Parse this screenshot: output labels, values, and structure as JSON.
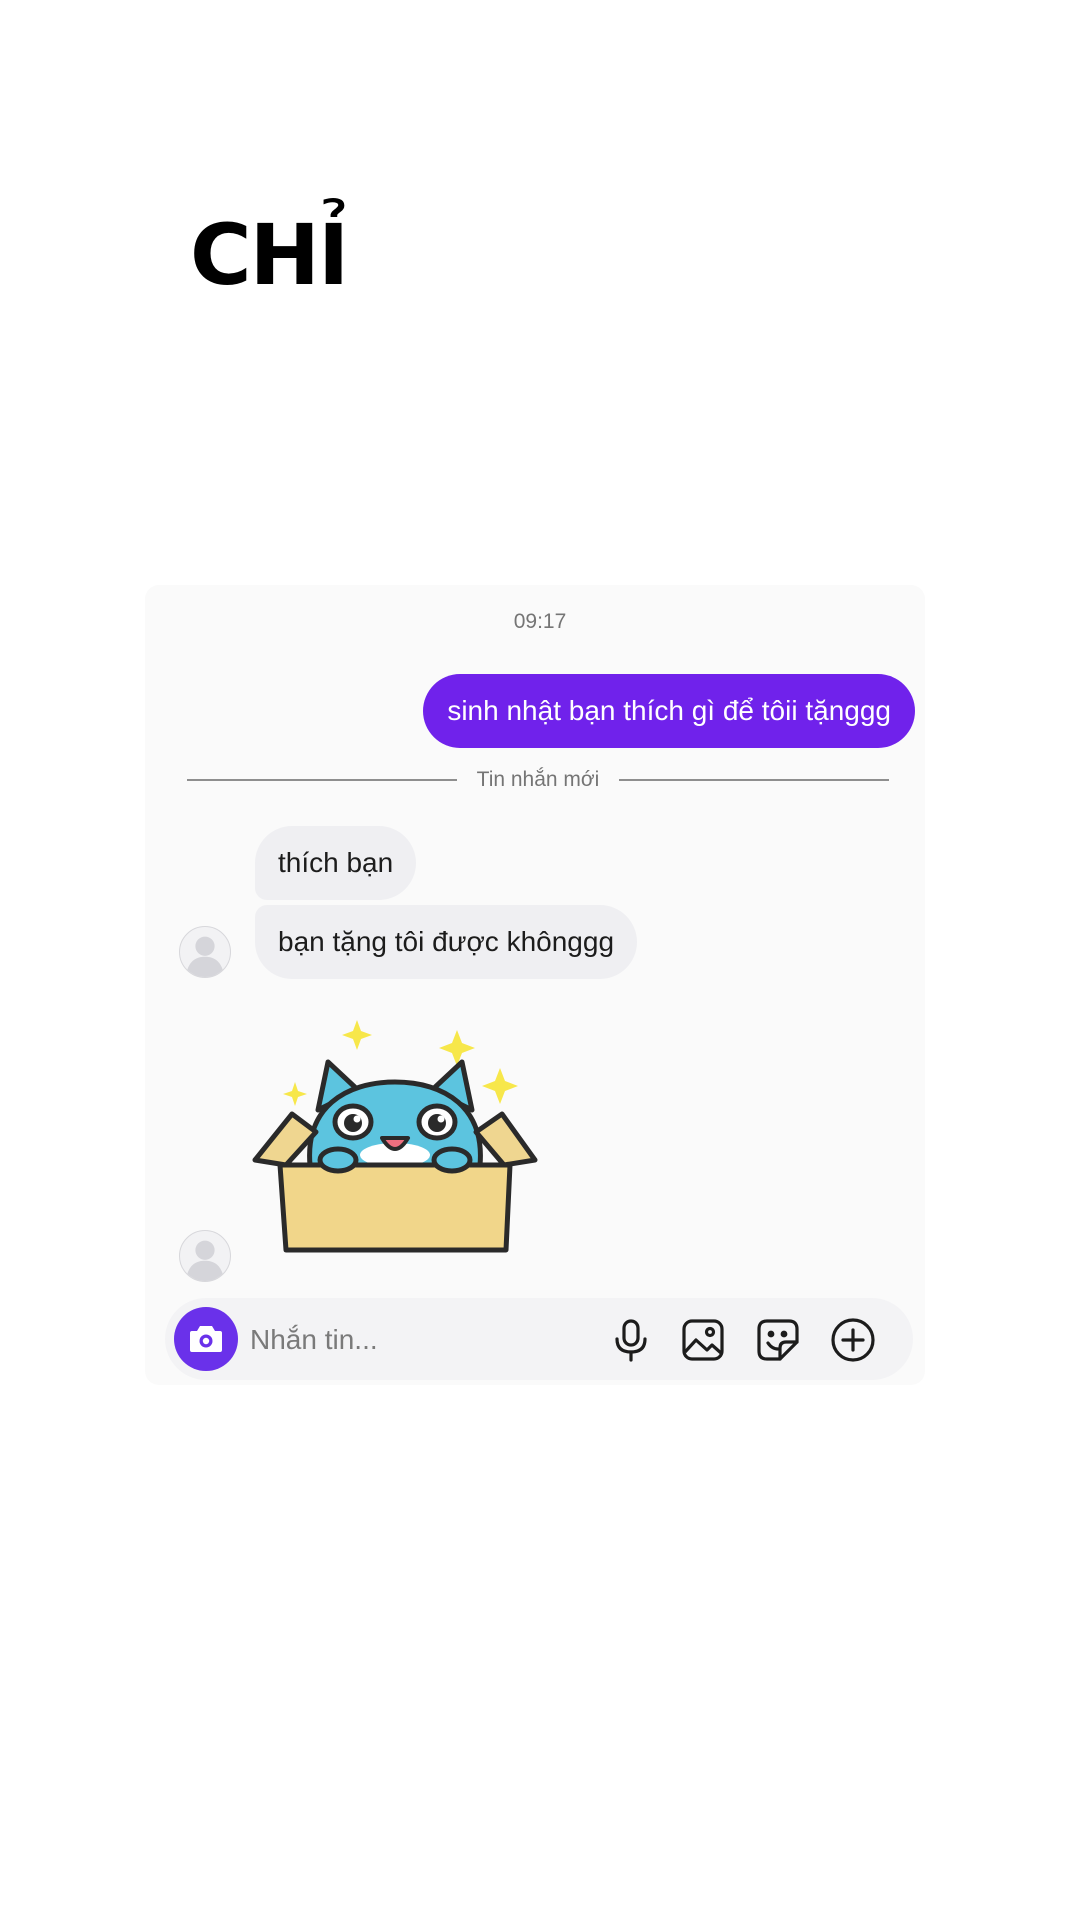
{
  "overlay": {
    "caption": "CHỈ"
  },
  "chat": {
    "time": "09:17",
    "outgoing": [
      {
        "text": "sinh nhật bạn thích gì để tôii tặnggg"
      }
    ],
    "divider_label": "Tin nhắn mới",
    "incoming": [
      {
        "text": "thích bạn"
      },
      {
        "text": "bạn tặng tôi được khônggg"
      }
    ]
  },
  "composer": {
    "placeholder": "Nhắn tin...",
    "value": "",
    "icons": [
      "camera-icon",
      "microphone-icon",
      "image-icon",
      "sticker-icon",
      "add-circle-icon"
    ]
  },
  "colors": {
    "outgoing_bubble": "#7022eb",
    "incoming_bubble": "#efeff2",
    "camera_button": "#6a31ea"
  }
}
